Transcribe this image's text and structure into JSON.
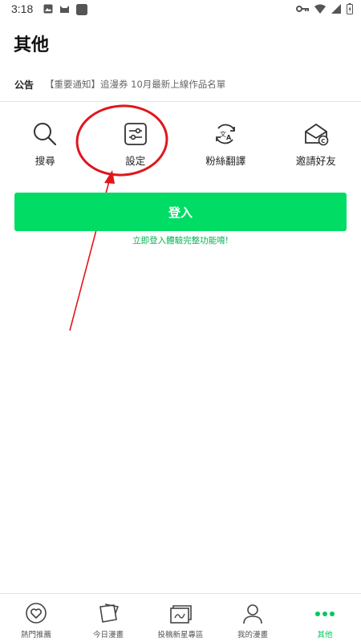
{
  "status_bar": {
    "time": "3:18"
  },
  "header": {
    "title": "其他"
  },
  "notice": {
    "label": "公告",
    "text": "【重要通知】追漫券 10月最新上線作品名單"
  },
  "menu": [
    {
      "label": "搜尋",
      "icon": "search-icon"
    },
    {
      "label": "設定",
      "icon": "settings-sliders-icon"
    },
    {
      "label": "粉絲翻譯",
      "icon": "translate-icon"
    },
    {
      "label": "邀請好友",
      "icon": "invite-mail-icon"
    }
  ],
  "login": {
    "button_label": "登入",
    "hint": "立即登入體驗完整功能唷!"
  },
  "bottom_nav": [
    {
      "label": "熱門推薦",
      "icon": "heart-icon",
      "active": false
    },
    {
      "label": "今日漫畫",
      "icon": "pages-icon",
      "active": false
    },
    {
      "label": "投稿新星專區",
      "icon": "canvas-icon",
      "active": false
    },
    {
      "label": "我的漫畫",
      "icon": "person-icon",
      "active": false
    },
    {
      "label": "其他",
      "icon": "more-dots-icon",
      "active": true
    }
  ],
  "colors": {
    "accent": "#00dc64",
    "annotation": "#e0161c"
  }
}
